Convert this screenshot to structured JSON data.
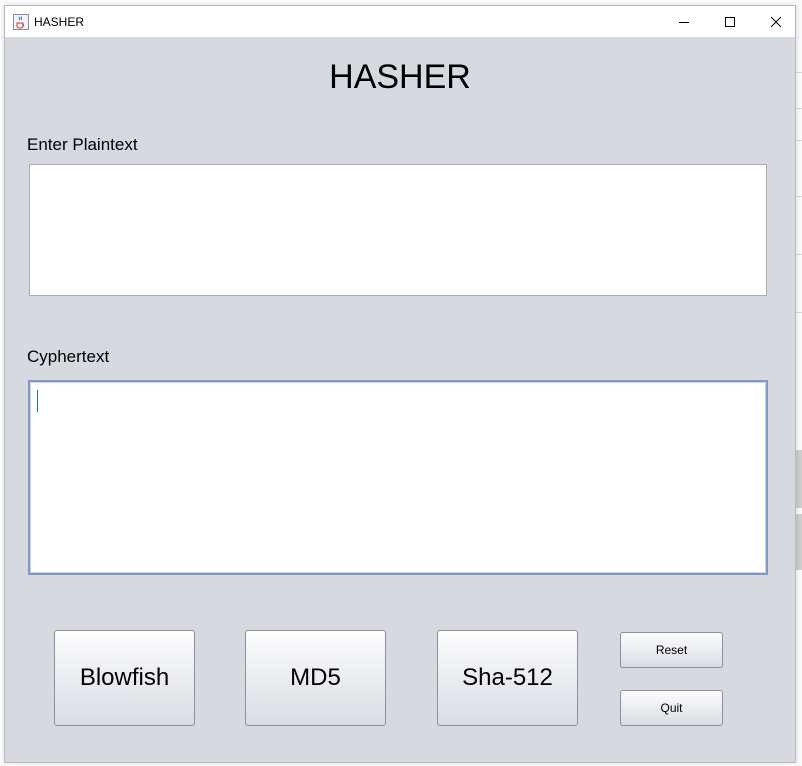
{
  "window": {
    "title": "HASHER",
    "icon": "java-coffee-cup-icon",
    "controls": [
      "minimize-icon",
      "maximize-icon",
      "close-icon"
    ]
  },
  "main": {
    "heading": "HASHER",
    "plaintext_label": "Enter Plaintext",
    "plaintext_value": "",
    "cyphertext_label": "Cyphertext",
    "cyphertext_value": ""
  },
  "buttons": {
    "blowfish": "Blowfish",
    "md5": "MD5",
    "sha512": "Sha-512",
    "reset": "Reset",
    "quit": "Quit"
  },
  "colors": {
    "window_background": "#d6d9df",
    "focus_border": "#7e9ac2",
    "caret": "#1b8a3c"
  }
}
